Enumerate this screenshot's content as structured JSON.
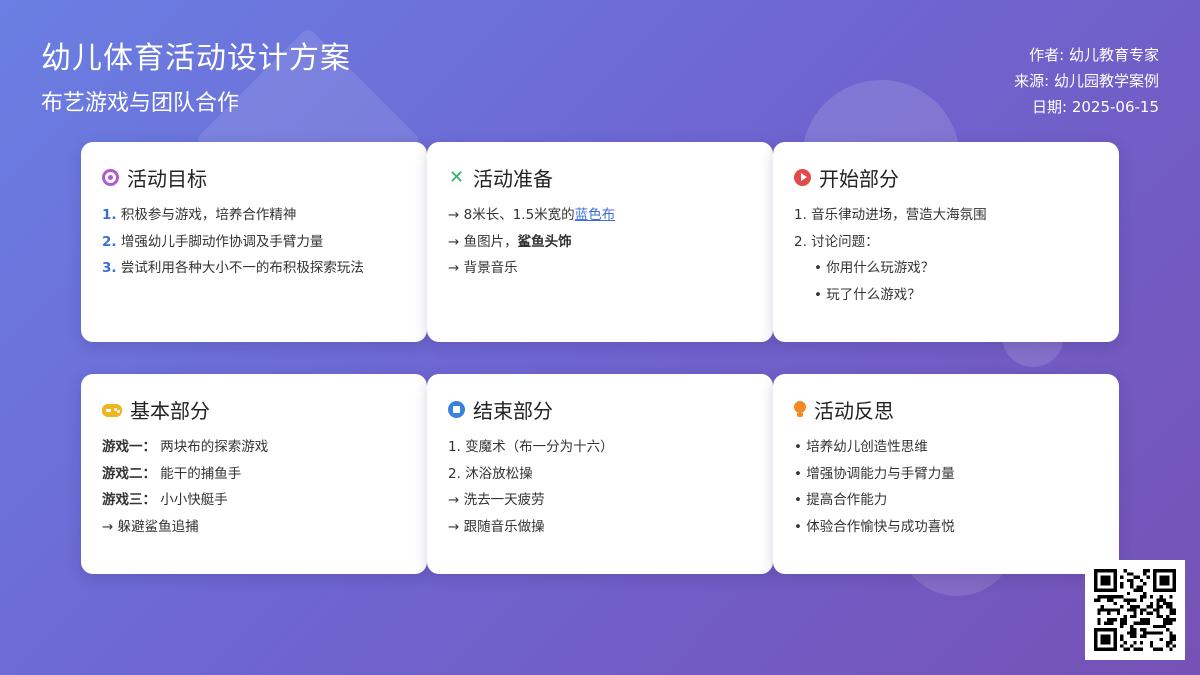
{
  "header": {
    "title": "幼儿体育活动设计方案",
    "subtitle": "布艺游戏与团队合作"
  },
  "meta": {
    "author": "作者: 幼儿教育专家",
    "source": "来源: 幼儿园教学案例",
    "date": "日期: 2025-06-15"
  },
  "cards": {
    "goals": {
      "icon": "target-icon",
      "title": "活动目标",
      "items": [
        {
          "num": "1.",
          "text": "积极参与游戏，培养合作精神"
        },
        {
          "num": "2.",
          "text": "增强幼儿手脚动作协调及手臂力量"
        },
        {
          "num": "3.",
          "text": "尝试利用各种大小不一的布积极探索玩法"
        }
      ]
    },
    "prep": {
      "icon": "tools-icon",
      "title": "活动准备",
      "item1_prefix": "→ 8米长、1.5米宽的",
      "item1_link": "蓝色布",
      "item2_prefix": "→ 鱼图片，",
      "item2_bold": "鲨鱼头饰",
      "item3": "→ 背景音乐"
    },
    "start": {
      "icon": "play-icon",
      "title": "开始部分",
      "items": [
        "1. 音乐律动进场，营造大海氛围",
        "2. 讨论问题："
      ],
      "sub_items": [
        "• 你用什么玩游戏？",
        "• 玩了什么游戏？"
      ]
    },
    "basic": {
      "icon": "gamepad-icon",
      "title": "基本部分",
      "games": [
        {
          "label": "游戏一：",
          "text": "两块布的探索游戏"
        },
        {
          "label": "游戏二：",
          "text": "能干的捕鱼手"
        },
        {
          "label": "游戏三：",
          "text": "小小快艇手"
        }
      ],
      "extra": "→ 躲避鲨鱼追捕"
    },
    "end": {
      "icon": "stop-icon",
      "title": "结束部分",
      "items": [
        "1. 变魔术（布一分为十六）",
        "2. 沐浴放松操",
        "→ 洗去一天疲劳",
        "→ 跟随音乐做操"
      ]
    },
    "reflection": {
      "icon": "lightbulb-icon",
      "title": "活动反思",
      "items": [
        "• 培养幼儿创造性思维",
        "• 增强协调能力与手臂力量",
        "• 提高合作能力",
        "• 体验合作愉快与成功喜悦"
      ]
    }
  },
  "colors": {
    "accent": "#3b6fd6",
    "bg_start": "#6a7fe3",
    "bg_end": "#7652b6"
  },
  "qr_icon": "qr-code-icon"
}
